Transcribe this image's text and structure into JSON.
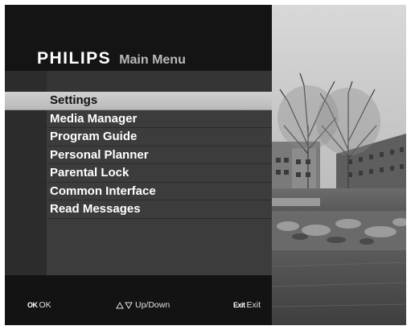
{
  "header": {
    "brand": "PHILIPS",
    "title": "Main Menu"
  },
  "menu": {
    "items": [
      {
        "label": "Settings",
        "selected": true
      },
      {
        "label": "Media Manager",
        "selected": false
      },
      {
        "label": "Program Guide",
        "selected": false
      },
      {
        "label": "Personal Planner",
        "selected": false
      },
      {
        "label": "Parental Lock",
        "selected": false
      },
      {
        "label": "Common Interface",
        "selected": false
      },
      {
        "label": "Read Messages",
        "selected": false
      }
    ]
  },
  "footer": {
    "ok_key": "OK",
    "ok_label": "OK",
    "updown_label": "Up/Down",
    "exit_key": "Exit",
    "exit_label": "Exit"
  },
  "icons": {
    "ok": "ok-key-icon",
    "updown": "up-down-arrows-icon",
    "exit": "exit-key-icon"
  },
  "colors": {
    "osd_background": "#151515",
    "menu_background": "#3c3c3c",
    "highlight": "#c6c6c6",
    "text": "#ffffff"
  }
}
